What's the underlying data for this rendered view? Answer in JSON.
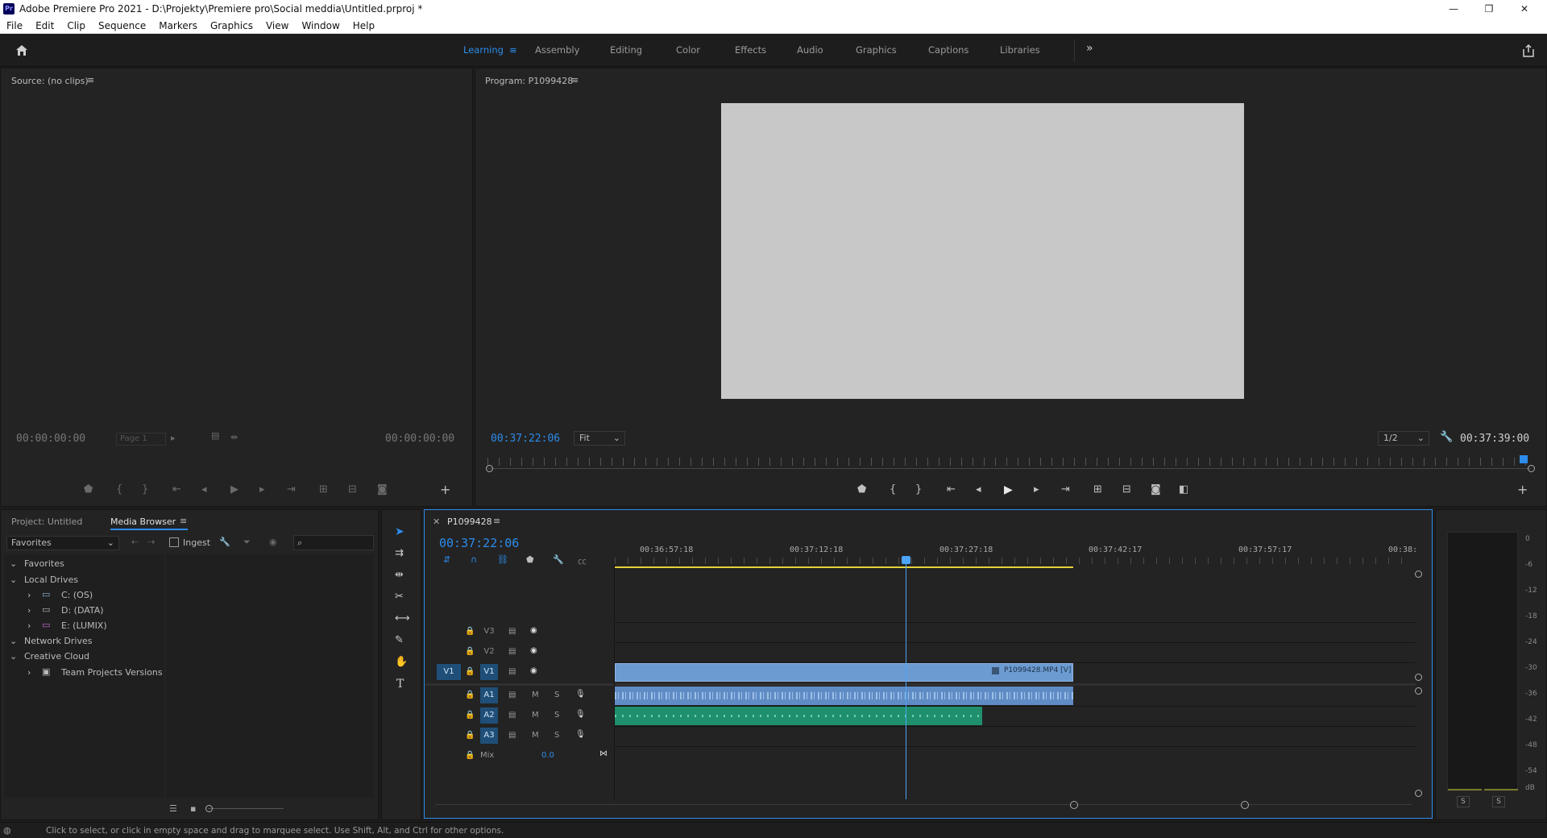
{
  "window": {
    "title": "Adobe Premiere Pro 2021 - D:\\Projekty\\Premiere pro\\Social meddia\\Untitled.prproj *",
    "logo_text": "Pr",
    "minimize": "—",
    "restore": "❐",
    "close": "✕"
  },
  "menu": [
    "File",
    "Edit",
    "Clip",
    "Sequence",
    "Markers",
    "Graphics",
    "View",
    "Window",
    "Help"
  ],
  "workspaces": {
    "items": [
      "Learning",
      "Assembly",
      "Editing",
      "Color",
      "Effects",
      "Audio",
      "Graphics",
      "Captions",
      "Libraries"
    ],
    "active": "Learning",
    "more": "»"
  },
  "source_monitor": {
    "title": "Source: (no clips)",
    "timecode_in": "00:00:00:00",
    "timecode_out": "00:00:00:00",
    "page": "Page 1"
  },
  "program_monitor": {
    "title": "Program: P1099428",
    "timecode": "00:37:22:06",
    "fit": "Fit",
    "resolution": "1/2",
    "duration": "00:37:39:00"
  },
  "project_panel": {
    "tab_project": "Project: Untitled",
    "tab_media": "Media Browser",
    "favorites_select": "Favorites",
    "ingest": "Ingest",
    "tree": {
      "favorites": "Favorites",
      "local_drives": "Local Drives",
      "drives": [
        "C: (OS)",
        "D: (DATA)",
        "E: (LUMIX)"
      ],
      "network": "Network Drives",
      "creative_cloud": "Creative Cloud",
      "team": "Team Projects Versions"
    }
  },
  "timeline": {
    "sequence": "P1099428",
    "timecode": "00:37:22:06",
    "ruler": [
      "00:36:57:18",
      "00:37:12:18",
      "00:37:27:18",
      "00:37:42:17",
      "00:37:57:17",
      "00:38:"
    ],
    "video_tracks": [
      "V3",
      "V2",
      "V1"
    ],
    "audio_tracks": [
      "A1",
      "A2",
      "A3"
    ],
    "source_patch_v": "V1",
    "mix_label": "Mix",
    "mix_value": "0.0",
    "clip_name": "P1099428.MP4 [V]",
    "m": "M",
    "s": "S"
  },
  "meter": {
    "scale": [
      "0",
      "-6",
      "-12",
      "-18",
      "-24",
      "-30",
      "-36",
      "-42",
      "-48",
      "-54",
      "dB"
    ],
    "solo": [
      "S",
      "S"
    ]
  },
  "status_bar": "Click to select, or click in empty space and drag to marquee select. Use Shift, Alt, and Ctrl for other options.",
  "colors": {
    "accent": "#2d8ceb",
    "video_clip": "#6b9bd1",
    "audio_clip": "#1f8f6d",
    "work_area": "#e6d23a"
  }
}
